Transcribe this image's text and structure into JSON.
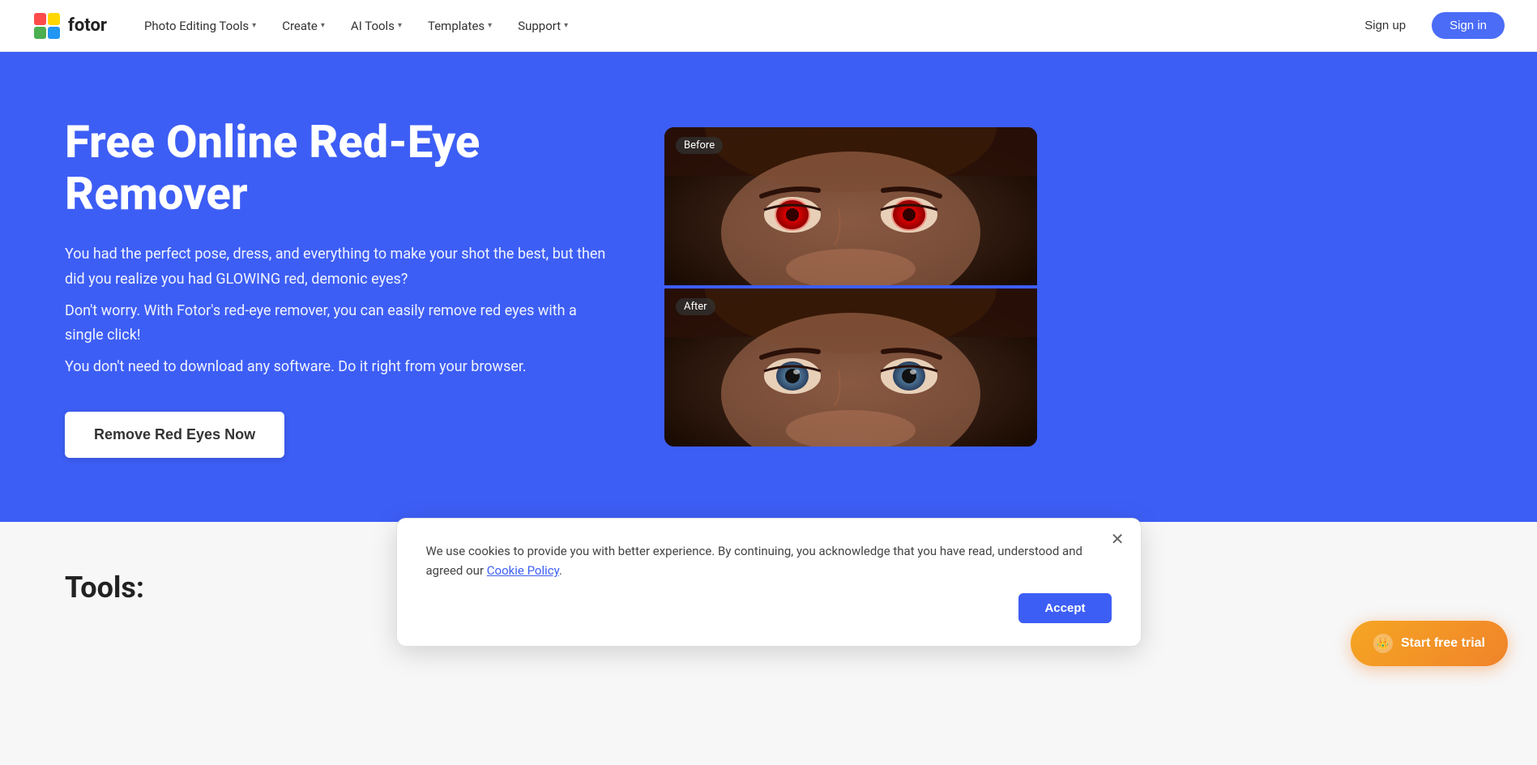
{
  "brand": {
    "name": "fotor"
  },
  "navbar": {
    "photo_editing_tools": "Photo Editing Tools",
    "create": "Create",
    "ai_tools": "AI Tools",
    "templates": "Templates",
    "support": "Support",
    "signup": "Sign up",
    "signin": "Sign in"
  },
  "hero": {
    "title": "Free Online Red-Eye Remover",
    "description_1": "You had the perfect pose, dress, and everything to make your shot the best, but then did you realize you had GLOWING red, demonic eyes?",
    "description_2": "Don't worry. With Fotor's red-eye remover, you can easily remove red eyes with a single click!",
    "description_3": "You don't need to download any software. Do it right from your browser.",
    "cta_button": "Remove Red Eyes Now",
    "before_label": "Before",
    "after_label": "After"
  },
  "below_hero": {
    "title": "Tools:"
  },
  "cookie": {
    "text_main": "We use cookies to provide you with better experience. By continuing, you acknowledge that you have read, understood and agreed our",
    "link_text": "Cookie Policy",
    "text_end": ".",
    "accept_button": "Accept"
  },
  "trial": {
    "button_label": "Start free trial"
  },
  "colors": {
    "hero_bg": "#3d5ef5",
    "cta_bg": "#ffffff",
    "signin_bg": "#4a6cf7",
    "trial_bg": "#f0832a",
    "accept_bg": "#3d5ef5"
  }
}
